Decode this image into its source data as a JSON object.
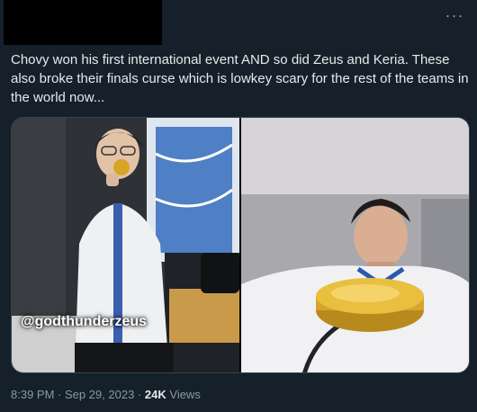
{
  "tweet": {
    "more_label": "···",
    "text": "Chovy won his first international event AND so did Zeus and Keria. These also broke their finals curse which is lowkey scary for the rest of the teams in the world now...",
    "photos": [
      {
        "watermark": "@godthunderzeus"
      }
    ],
    "meta": {
      "time": "8:39 PM",
      "separator": " · ",
      "date": "Sep 29, 2023",
      "views_count": "24K",
      "views_label": " Views"
    }
  },
  "colors": {
    "background": "#15202b",
    "text": "#e7e9ea",
    "secondary_text": "#8b98a5",
    "border": "#38444d"
  }
}
